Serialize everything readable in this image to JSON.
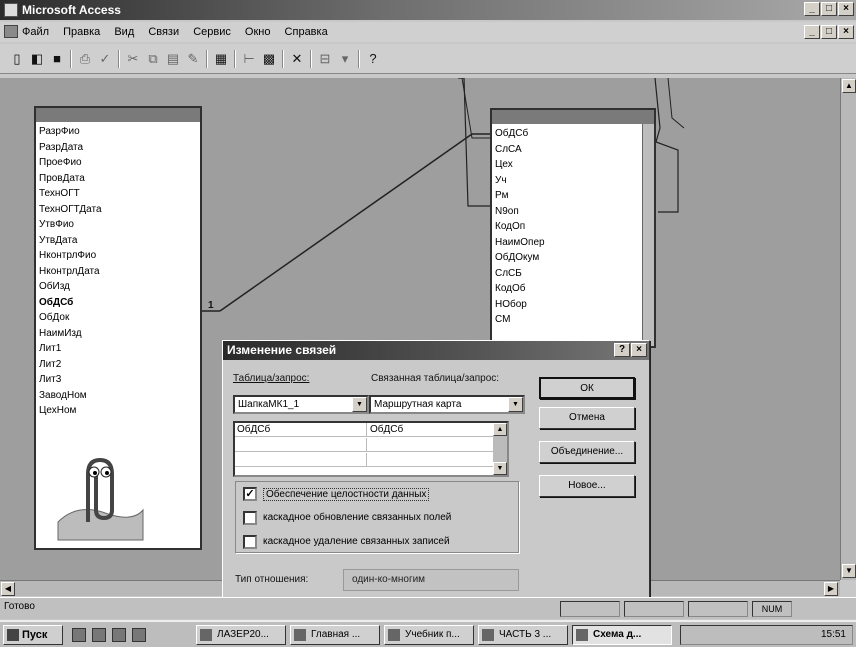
{
  "window": {
    "title": "Microsoft Access"
  },
  "menu": [
    "Файл",
    "Правка",
    "Вид",
    "Связи",
    "Сервис",
    "Окно",
    "Справка"
  ],
  "table_left": {
    "fields": [
      "РазрФио",
      "РазрДата",
      "ПроеФио",
      "ПровДата",
      "ТехнОГТ",
      "ТехнОГТДата",
      "УтвФио",
      "УтвДата",
      "НконтрлФио",
      "НконтрлДата",
      "ОбИзд",
      "ОбДСб",
      "ОбДок",
      "НаимИзд",
      "Лит1",
      "Лит2",
      "Лит3",
      "ЗаводНом",
      "ЦехНом"
    ],
    "key_field": "ОбДСб"
  },
  "table_right": {
    "fields": [
      "ОбДСб",
      "СлСА",
      "Цех",
      "Уч",
      "Рм",
      "N9оп",
      "КодОп",
      "НаимОпер",
      "ОбДОкум",
      "СлСБ",
      "КодОб",
      "НОбор",
      "СМ"
    ]
  },
  "relation": {
    "one_label": "1"
  },
  "dialog": {
    "title": "Изменение связей",
    "table_label": "Таблица/запрос:",
    "related_label": "Связанная таблица/запрос:",
    "table_value": "ШапкаМК1_1",
    "related_value": "Маршрутная карта",
    "grid_rows": [
      {
        "left": "ОбДСб",
        "right": "ОбДСб"
      }
    ],
    "checkboxes": [
      {
        "label": "Обеспечение целостности данных",
        "checked": true
      },
      {
        "label": "каскадное обновление связанных полей",
        "checked": false
      },
      {
        "label": "каскадное удаление связанных записей",
        "checked": false
      }
    ],
    "buttons": {
      "ok": "ОК",
      "cancel": "Отмена",
      "join": "Объединение...",
      "new": "Новое..."
    },
    "reltype_label": "Тип отношения:",
    "reltype_value": "один-ко-многим"
  },
  "status": {
    "text": "Готово",
    "num": "NUM"
  },
  "taskbar": {
    "start": "Пуск",
    "tasks": [
      "ЛАЗЕР20...",
      "Главная ...",
      "Учебник п...",
      "ЧАСТЬ 3 ...",
      "Схема д..."
    ],
    "clock": "15:51"
  }
}
